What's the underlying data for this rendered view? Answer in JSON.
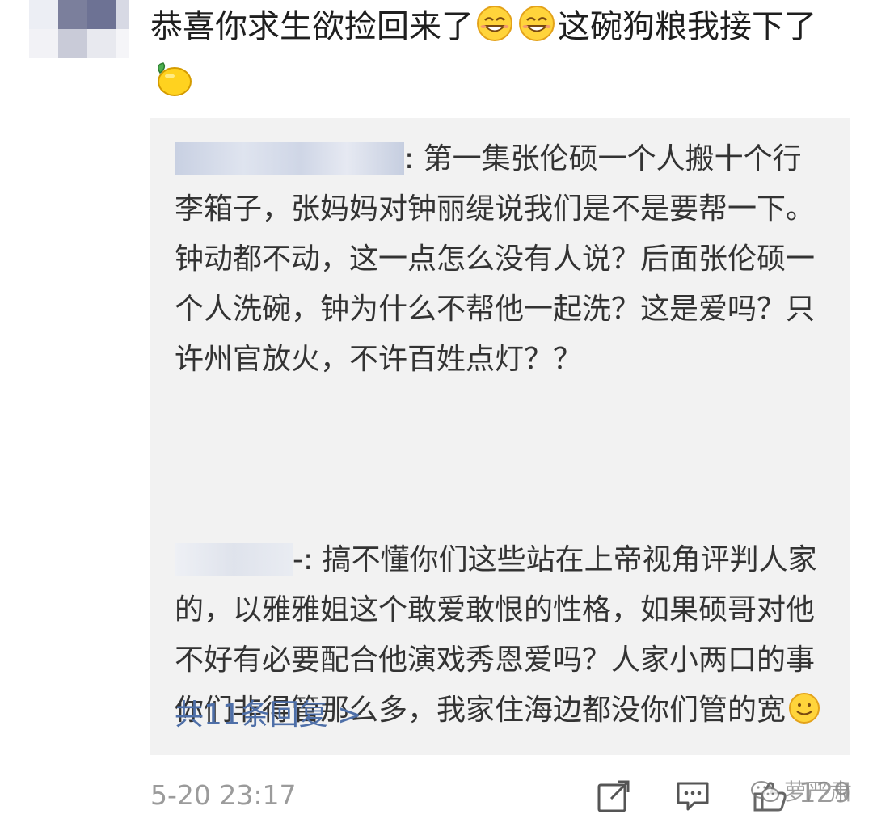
{
  "comment": {
    "text_part1": "恭喜你求生欲捡回来了",
    "text_part2": "这碗狗粮我接下了",
    "timestamp": "5-20 23:17",
    "like_count": "129"
  },
  "replies": [
    {
      "text": ": 第一集张伦硕一个人搬十个行李箱子，张妈妈对钟丽缇说我们是不是要帮一下。钟动都不动，这一点怎么没有人说？后面张伦硕一个人洗碗，钟为什么不帮他一起洗？这是爱吗？只许州官放火，不许百姓点灯？？"
    },
    {
      "text": "-: 搞不懂你们这些站在上帝视角评判人家的，以雅雅姐这个敢爱敢恨的性格，如果硕哥对他不好有必要配合他演戏秀恩爱吗？人家小两口的事你们非得管那么多，我家住海边都没你们管的宽"
    }
  ],
  "view_replies_label": "共11条回复 >",
  "watermark_text": "萝严肃",
  "icons": {
    "emoji_grin": "grinning-face-icon",
    "emoji_lemon": "lemon-icon",
    "emoji_smile": "smiling-face-icon",
    "share": "share-icon",
    "reply": "comment-icon",
    "like": "thumbs-up-icon",
    "watermark": "wechat-icon"
  },
  "colors": {
    "link": "#4e6fa8",
    "muted": "#9b9b9b",
    "reply_bg": "#f2f2f2"
  }
}
